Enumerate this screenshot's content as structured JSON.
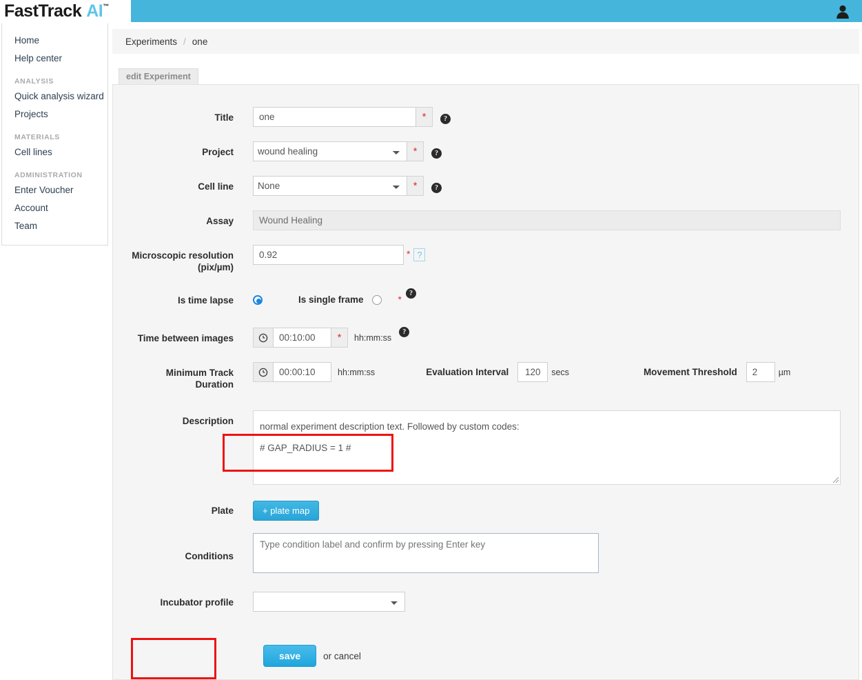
{
  "app": {
    "logo_primary": "FastTrack",
    "logo_accent": "AI",
    "logo_tm": "™",
    "header_color": "#45b5dc",
    "accent_color": "#2aa5d8",
    "annotation_color": "#ee1111"
  },
  "topbar": {
    "avatar_icon": "user-silhouette-icon"
  },
  "sidebar": {
    "items": [
      {
        "label": "Home",
        "type": "link"
      },
      {
        "label": "Help center",
        "type": "link"
      },
      {
        "label": "ANALYSIS",
        "type": "heading"
      },
      {
        "label": "Quick analysis wizard",
        "type": "link"
      },
      {
        "label": "Projects",
        "type": "link"
      },
      {
        "label": "MATERIALS",
        "type": "heading"
      },
      {
        "label": "Cell lines",
        "type": "link"
      },
      {
        "label": "ADMINISTRATION",
        "type": "heading"
      },
      {
        "label": "Enter Voucher",
        "type": "link"
      },
      {
        "label": "Account",
        "type": "link"
      },
      {
        "label": "Team",
        "type": "link"
      }
    ]
  },
  "breadcrumb": {
    "root": "Experiments",
    "separator": "/",
    "current": "one"
  },
  "tab": {
    "label": "edit Experiment"
  },
  "form": {
    "title": {
      "label": "Title",
      "value": "one",
      "required_mark": "*",
      "help_icon": "question-mark-circle-icon"
    },
    "project": {
      "label": "Project",
      "value": "wound healing",
      "options": [
        "wound healing"
      ],
      "required_mark": "*",
      "help_icon": "question-mark-circle-icon"
    },
    "cell_line": {
      "label": "Cell line",
      "value": "None",
      "options": [
        "None"
      ],
      "required_mark": "*",
      "help_icon": "question-mark-circle-icon"
    },
    "assay": {
      "label": "Assay",
      "value": "Wound Healing"
    },
    "resolution": {
      "label_line1": "Microscopic resolution",
      "label_line2": "(pix/µm)",
      "value": "0.92",
      "required_mark": "*",
      "help_label": "?"
    },
    "frame_mode": {
      "timelapse_label": "Is time lapse",
      "timelapse_selected": true,
      "singleframe_label": "Is single frame",
      "singleframe_selected": false,
      "required_mark": "*",
      "help_icon": "question-mark-circle-icon"
    },
    "time_between_images": {
      "label": "Time between images",
      "value": "00:10:00",
      "unit": "hh:mm:ss",
      "required_mark": "*",
      "clock_icon": "clock-icon",
      "help_icon": "question-mark-circle-icon"
    },
    "minimum_track_duration": {
      "label_line1": "Minimum Track",
      "label_line2": "Duration",
      "value": "00:00:10",
      "unit": "hh:mm:ss",
      "clock_icon": "clock-icon"
    },
    "evaluation_interval": {
      "label": "Evaluation Interval",
      "value": "120",
      "unit": "secs"
    },
    "movement_threshold": {
      "label": "Movement Threshold",
      "value": "2",
      "unit": "µm"
    },
    "description": {
      "label": "Description",
      "line1": "normal experiment description text. Followed by custom codes:",
      "line2": "# GAP_RADIUS = 1 #"
    },
    "plate": {
      "label": "Plate",
      "button_label": "+ plate map"
    },
    "conditions": {
      "label": "Conditions",
      "placeholder": "Type condition label and confirm by pressing Enter key",
      "value": ""
    },
    "incubator_profile": {
      "label": "Incubator profile",
      "value": "",
      "options": [
        ""
      ]
    },
    "actions": {
      "save_label": "save",
      "or_cancel_label": "or cancel"
    }
  }
}
